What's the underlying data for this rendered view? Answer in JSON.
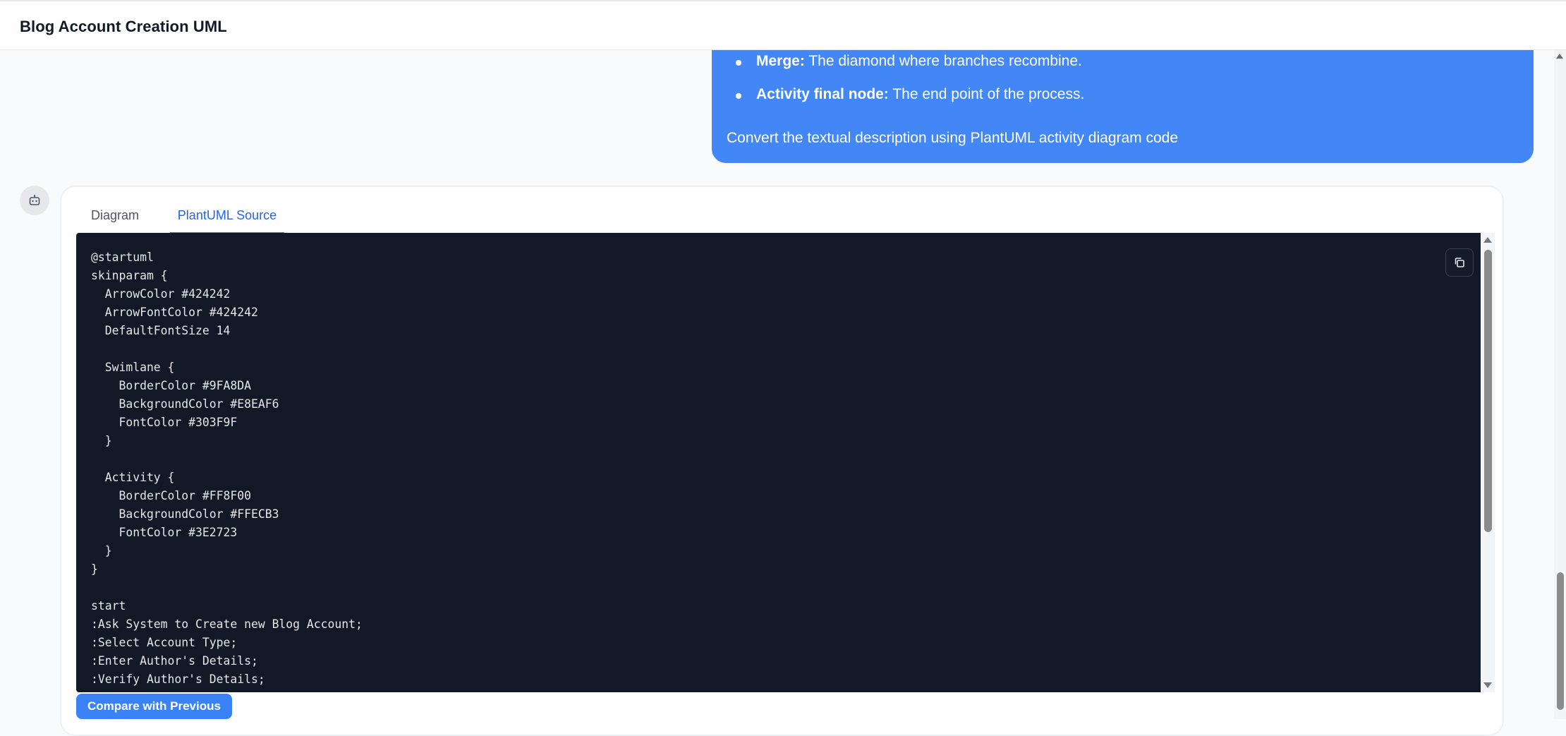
{
  "header": {
    "title": "Blog Account Creation UML"
  },
  "user_message": {
    "bullets": [
      {
        "term": "Merge:",
        "text": " The diamond where branches recombine."
      },
      {
        "term": "Activity final node:",
        "text": " The end point of the process."
      }
    ],
    "closing": "Convert the textual description using PlantUML activity diagram code"
  },
  "assistant": {
    "avatar_icon": "robot-icon",
    "tabs": [
      {
        "label": "Diagram",
        "active": false
      },
      {
        "label": "PlantUML Source",
        "active": true
      }
    ],
    "code": "@startuml\nskinparam {\n  ArrowColor #424242\n  ArrowFontColor #424242\n  DefaultFontSize 14\n\n  Swimlane {\n    BorderColor #9FA8DA\n    BackgroundColor #E8EAF6\n    FontColor #303F9F\n  }\n\n  Activity {\n    BorderColor #FF8F00\n    BackgroundColor #FFECB3\n    FontColor #3E2723\n  }\n}\n\nstart\n:Ask System to Create new Blog Account;\n:Select Account Type;\n:Enter Author's Details;\n:Verify Author's Details;",
    "copy_icon": "copy-icon",
    "compare_button": "Compare with Previous"
  },
  "colors": {
    "accent": "#3b82f6",
    "user_bubble": "#4287f5",
    "code_bg": "#121826"
  }
}
